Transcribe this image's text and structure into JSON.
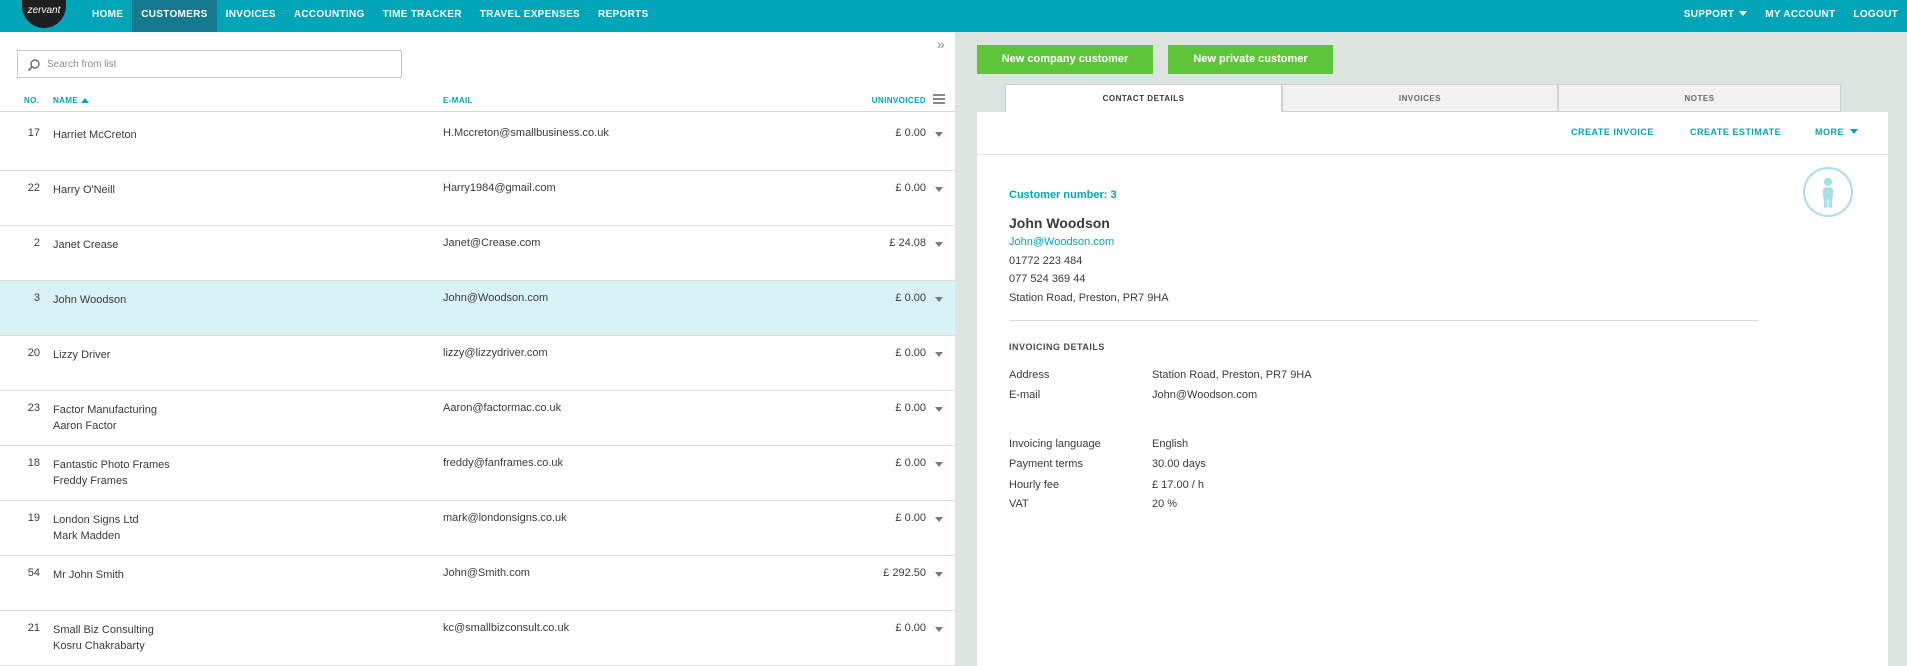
{
  "app": {
    "logo_text": "zervant"
  },
  "nav": {
    "items": [
      "HOME",
      "CUSTOMERS",
      "INVOICES",
      "ACCOUNTING",
      "TIME TRACKER",
      "TRAVEL EXPENSES",
      "REPORTS"
    ],
    "active": "CUSTOMERS",
    "right_items": [
      "SUPPORT",
      "MY ACCOUNT",
      "LOGOUT"
    ]
  },
  "search": {
    "placeholder": "Search from list"
  },
  "table": {
    "headers": {
      "no": "NO.",
      "name": "NAME",
      "email": "E-MAIL",
      "uninvoiced": "UNINVOICED"
    },
    "rows": [
      {
        "no": "17",
        "name": "Harriet McCreton",
        "contact": "",
        "email": "H.Mccreton@smallbusiness.co.uk",
        "amount": "£ 0.00"
      },
      {
        "no": "22",
        "name": "Harry O'Neill",
        "contact": "",
        "email": "Harry1984@gmail.com",
        "amount": "£ 0.00"
      },
      {
        "no": "2",
        "name": "Janet Crease",
        "contact": "",
        "email": "Janet@Crease.com",
        "amount": "£ 24.08"
      },
      {
        "no": "3",
        "name": "John Woodson",
        "contact": "",
        "email": "John@Woodson.com",
        "amount": "£ 0.00",
        "selected": true
      },
      {
        "no": "20",
        "name": "Lizzy Driver",
        "contact": "",
        "email": "lizzy@lizzydriver.com",
        "amount": "£ 0.00"
      },
      {
        "no": "23",
        "name": "Factor Manufacturing",
        "contact": "Aaron Factor",
        "email": "Aaron@factormac.co.uk",
        "amount": "£ 0.00"
      },
      {
        "no": "18",
        "name": "Fantastic Photo Frames",
        "contact": "Freddy Frames",
        "email": "freddy@fanframes.co.uk",
        "amount": "£ 0.00"
      },
      {
        "no": "19",
        "name": "London Signs Ltd",
        "contact": "Mark Madden",
        "email": "mark@londonsigns.co.uk",
        "amount": "£ 0.00"
      },
      {
        "no": "54",
        "name": "Mr John Smith",
        "contact": "",
        "email": "John@Smith.com",
        "amount": "£ 292.50"
      },
      {
        "no": "21",
        "name": "Small Biz Consulting",
        "contact": "Kosru Chakrabarty",
        "email": "kc@smallbizconsult.co.uk",
        "amount": "£ 0.00"
      }
    ]
  },
  "buttons": {
    "new_company": "New company customer",
    "new_private": "New private customer"
  },
  "tabs": [
    "CONTACT DETAILS",
    "INVOICES",
    "NOTES"
  ],
  "actions": {
    "create_invoice": "CREATE INVOICE",
    "create_estimate": "CREATE ESTIMATE",
    "more": "MORE"
  },
  "customer": {
    "number_label": "Customer number: 3",
    "name": "John Woodson",
    "email": "John@Woodson.com",
    "phone1": "01772 223 484",
    "phone2": "077 524 369 44",
    "address": "Station Road, Preston, PR7 9HA"
  },
  "invoicing": {
    "title": "INVOICING DETAILS",
    "address_label": "Address",
    "address": "Station Road, Preston, PR7 9HA",
    "email_label": "E-mail",
    "email": "John@Woodson.com",
    "language_label": "Invoicing language",
    "language": "English",
    "terms_label": "Payment terms",
    "terms": "30.00 days",
    "fee_label": "Hourly fee",
    "fee": "£ 17.00 / h",
    "vat_label": "VAT",
    "vat": "20 %"
  },
  "colors": {
    "brand": "#00a6b8",
    "active_nav": "#167a8e",
    "green": "#5ec53b",
    "selected_row": "#d9f2f5"
  }
}
